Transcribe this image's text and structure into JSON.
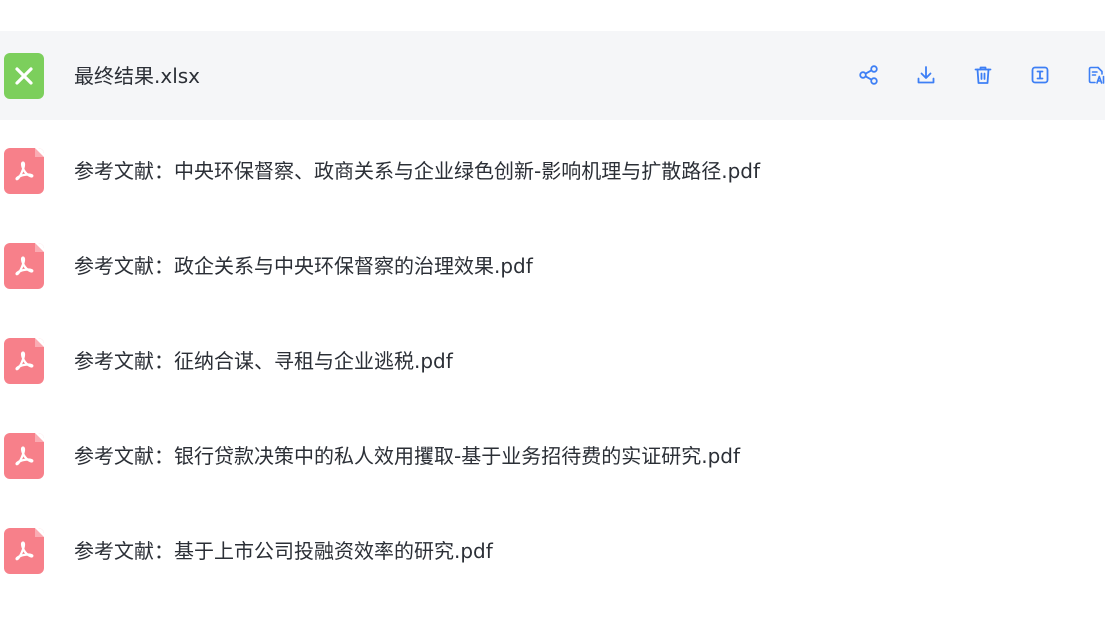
{
  "files": [
    {
      "name": "最终结果.xlsx",
      "type": "xlsx"
    },
    {
      "name": "参考文献：中央环保督察、政商关系与企业绿色创新-影响机理与扩散路径.pdf",
      "type": "pdf"
    },
    {
      "name": "参考文献：政企关系与中央环保督察的治理效果.pdf",
      "type": "pdf"
    },
    {
      "name": "参考文献：征纳合谋、寻租与企业逃税.pdf",
      "type": "pdf"
    },
    {
      "name": "参考文献：银行贷款决策中的私人效用攫取-基于业务招待费的实证研究.pdf",
      "type": "pdf"
    },
    {
      "name": "参考文献：基于上市公司投融资效率的研究.pdf",
      "type": "pdf"
    }
  ],
  "row_actions": [
    "share-icon",
    "download-icon",
    "trash-icon",
    "text-extract-icon",
    "ai-translate-icon"
  ],
  "colors": {
    "accent": "#3d7ff5",
    "xlsx": "#7ccf5c",
    "pdf": "#f7808a",
    "active_row": "#f5f6f8"
  }
}
